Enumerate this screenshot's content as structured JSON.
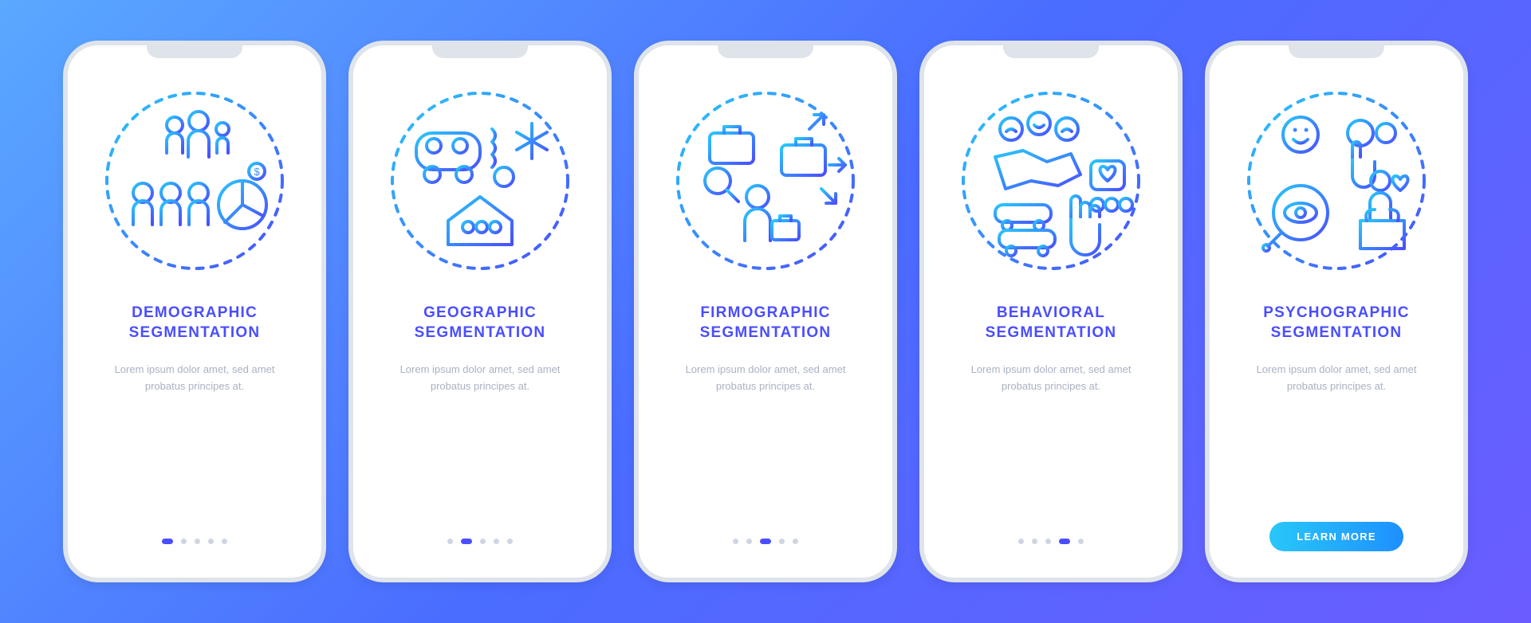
{
  "description_text": "Lorem ipsum dolor amet, sed amet probatus principes at.",
  "cta_label": "LEARN MORE",
  "screens": [
    {
      "title": "DEMOGRAPHIC\nSEGMENTATION",
      "icon": "demographic-icon",
      "active_index": 0,
      "show_cta": false
    },
    {
      "title": "GEOGRAPHIC\nSEGMENTATION",
      "icon": "geographic-icon",
      "active_index": 1,
      "show_cta": false
    },
    {
      "title": "FIRMOGRAPHIC\nSEGMENTATION",
      "icon": "firmographic-icon",
      "active_index": 2,
      "show_cta": false
    },
    {
      "title": "BEHAVIORAL\nSEGMENTATION",
      "icon": "behavioral-icon",
      "active_index": 3,
      "show_cta": false
    },
    {
      "title": "PSYCHOGRAPHIC\nSEGMENTATION",
      "icon": "psychographic-icon",
      "active_index": 4,
      "show_cta": true
    }
  ],
  "total_dots": 5,
  "colors": {
    "gradient_start": "#28c7fa",
    "gradient_end": "#4a4eff",
    "accent": "#4a4eff"
  }
}
